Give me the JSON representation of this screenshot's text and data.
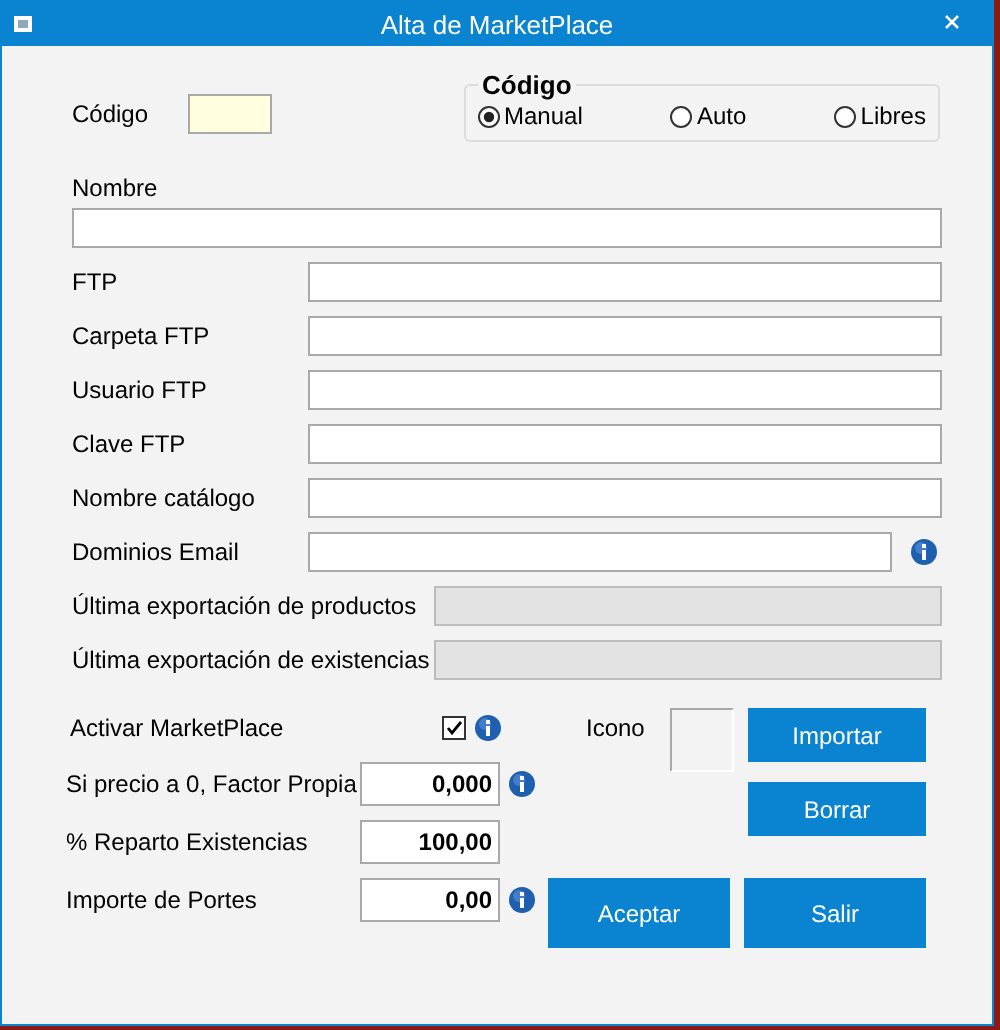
{
  "window": {
    "title": "Alta de MarketPlace"
  },
  "codigo": {
    "label": "Código"
  },
  "codigo_group": {
    "title": "Código",
    "options": [
      {
        "label": "Manual",
        "selected": true
      },
      {
        "label": "Auto",
        "selected": false
      },
      {
        "label": "Libres",
        "selected": false
      }
    ]
  },
  "nombre": {
    "label": "Nombre"
  },
  "fields": [
    {
      "label": "FTP",
      "disabled": false,
      "info": false
    },
    {
      "label": "Carpeta FTP",
      "disabled": false,
      "info": false
    },
    {
      "label": "Usuario FTP",
      "disabled": false,
      "info": false
    },
    {
      "label": "Clave FTP",
      "disabled": false,
      "info": false
    },
    {
      "label": "Nombre catálogo",
      "disabled": false,
      "info": false
    },
    {
      "label": "Dominios Email",
      "disabled": false,
      "info": true
    },
    {
      "label": "Última exportación de productos",
      "disabled": true,
      "info": false
    },
    {
      "label": "Última exportación de existencias",
      "disabled": true,
      "info": false
    }
  ],
  "activar": {
    "label": "Activar MarketPlace",
    "checked": true,
    "info": true
  },
  "numbers": [
    {
      "label": "Si precio a 0, Factor Propia",
      "value": "0,000",
      "info": true
    },
    {
      "label": "% Reparto Existencias",
      "value": "100,00",
      "info": false
    },
    {
      "label": "Importe de Portes",
      "value": "0,00",
      "info": true
    }
  ],
  "icono": {
    "label": "Icono",
    "buttons": [
      "Importar",
      "Borrar"
    ]
  },
  "buttons": [
    "Aceptar",
    "Salir"
  ]
}
